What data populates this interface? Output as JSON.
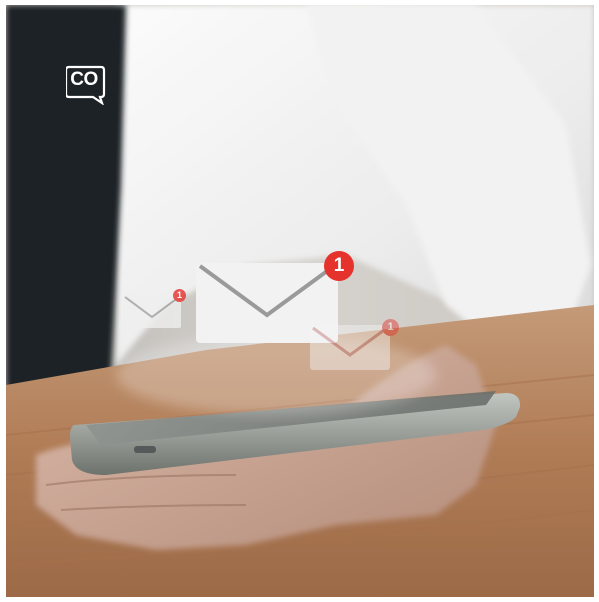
{
  "logo": {
    "text": "CO",
    "icon": "chat-bubble-logo-icon",
    "color": "#ffffff"
  },
  "notifications": [
    {
      "name": "large",
      "badge_count": "1",
      "badge_color": "#e5322d"
    },
    {
      "name": "small-left",
      "badge_count": "1",
      "badge_color": "#e5322d"
    },
    {
      "name": "small-right",
      "badge_count": "1",
      "badge_color": "#e5322d"
    }
  ],
  "colors": {
    "tie": "#1e2227",
    "shirt": "#eeeeef",
    "table": "#b6825c",
    "phone_frame": "#9ea39d",
    "phone_screen": "#7b7f7b"
  }
}
